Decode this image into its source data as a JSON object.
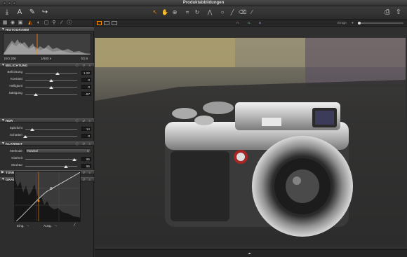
{
  "window": {
    "title": "Produktabbildungen"
  },
  "toolbar": {
    "left_icons": [
      "import-icon",
      "text-icon",
      "pen-icon",
      "redo-icon"
    ],
    "cursor_tools": [
      "cursor-icon",
      "hand-icon",
      "loupe-icon",
      "crop-icon",
      "rotate-icon",
      "keystone-icon",
      "spot-icon",
      "circle-icon",
      "brush-icon",
      "eraser-icon",
      "picker-icon"
    ],
    "right_icons": [
      "print-icon",
      "export-icon"
    ]
  },
  "tool_tabs": [
    "library",
    "capture",
    "camera",
    "exposure",
    "color",
    "lens",
    "detail",
    "local",
    "metadata",
    "output",
    "adjust",
    "info"
  ],
  "viewer_bar": {
    "channels": [
      "R",
      "G",
      "B"
    ],
    "right_text": "Einige"
  },
  "histogram": {
    "title": "HISTOGRAMM",
    "iso": "ISO 200",
    "shutter": "1/600 s",
    "aperture": "f/2.8"
  },
  "exposure": {
    "title": "BELICHTUNG",
    "rows": [
      {
        "label": "Belichtung",
        "value": "1.22",
        "pos": 0.62
      },
      {
        "label": "Kontrast",
        "value": "0",
        "pos": 0.5
      },
      {
        "label": "Helligkeit",
        "value": "0",
        "pos": 0.5
      },
      {
        "label": "Sättigung",
        "value": "-57",
        "pos": 0.2
      }
    ]
  },
  "hdr": {
    "title": "HDR",
    "rows": [
      {
        "label": "Spitzlicht",
        "value": "14",
        "pos": 0.14
      },
      {
        "label": "Schatten",
        "value": "0",
        "pos": 0.0
      }
    ]
  },
  "clarity": {
    "title": "KLARHEIT",
    "method_label": "Methode",
    "method_value": "Neutral",
    "rows": [
      {
        "label": "Klarheit",
        "value": "95",
        "pos": 0.95
      },
      {
        "label": "Struktur",
        "value": "55",
        "pos": 0.78
      }
    ]
  },
  "sections_collapsed": [
    {
      "title": "TONWERTE"
    }
  ],
  "curve": {
    "title": "GRADATIONSKURVE",
    "channels": [
      "RGB",
      "Rot",
      "Grün",
      "Blau"
    ],
    "active_channel": "RGB",
    "input_label": "Eing.",
    "output_label": "Ausg.",
    "input_value": "--",
    "output_value": "--"
  },
  "colors": {
    "accent": "#ff8a00",
    "panel": "#2d2d2d",
    "header": "#444444"
  }
}
